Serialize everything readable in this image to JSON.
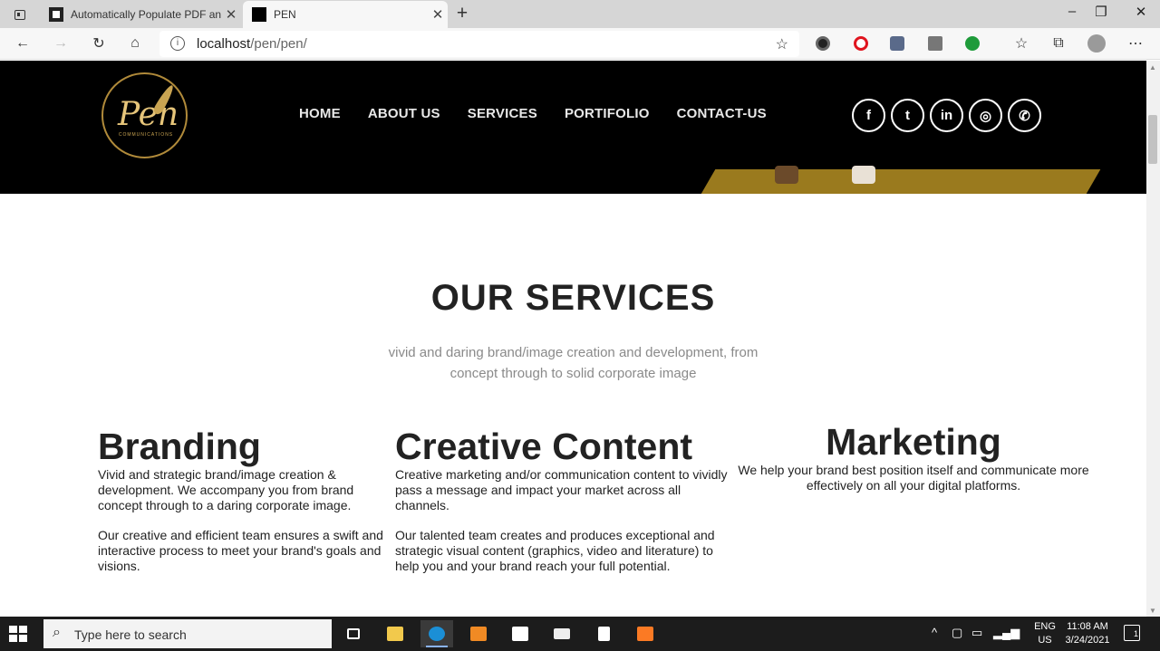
{
  "browser": {
    "tabs": [
      {
        "title": "Automatically Populate PDF and",
        "icon": "document-icon",
        "active": false
      },
      {
        "title": "PEN",
        "icon": "black-square-icon",
        "active": true
      }
    ],
    "url_host": "localhost",
    "url_path": "/pen/pen/",
    "window_controls": [
      "–",
      "❐",
      "✕"
    ]
  },
  "site": {
    "logo_text": "Pen",
    "logo_subtext": "COMMUNICATIONS",
    "nav": [
      "HOME",
      "ABOUT US",
      "SERVICES",
      "PORTIFOLIO",
      "CONTACT-US"
    ],
    "socials": [
      {
        "name": "facebook",
        "glyph": "f"
      },
      {
        "name": "twitter",
        "glyph": "t"
      },
      {
        "name": "linkedin",
        "glyph": "in"
      },
      {
        "name": "instagram",
        "glyph": "◎"
      },
      {
        "name": "whatsapp",
        "glyph": "✆"
      }
    ],
    "colors": {
      "header_bg": "#000000",
      "accent_gold": "#9a7a1e"
    }
  },
  "services": {
    "title": "OUR SERVICES",
    "subtitle_line1": "vivid and daring brand/image creation and development, from",
    "subtitle_line2": "concept through to solid corporate image",
    "branding": {
      "heading": "Branding",
      "p1": "Vivid and strategic brand/image  creation & development. We accompany you from brand concept through to a daring corporate image.",
      "p2": "Our creative and efficient team ensures a swift and interactive process to meet your brand's goals and visions."
    },
    "creative": {
      "heading": "Creative Content",
      "p1": "Creative marketing and/or communication content to vividly pass a  message and impact your market across all channels.",
      "p2": "Our talented team creates and produces exceptional and strategic visual content (graphics, video and literature) to help you and your brand reach your full potential."
    },
    "marketing": {
      "heading": "Marketing",
      "p1": "We help your brand best position itself and communicate more effectively on all your digital platforms."
    }
  },
  "taskbar": {
    "search_placeholder": "Type here to search",
    "lang_line1": "ENG",
    "lang_line2": "US",
    "time": "11:08 AM",
    "date": "3/24/2021",
    "notification_count": "1"
  }
}
